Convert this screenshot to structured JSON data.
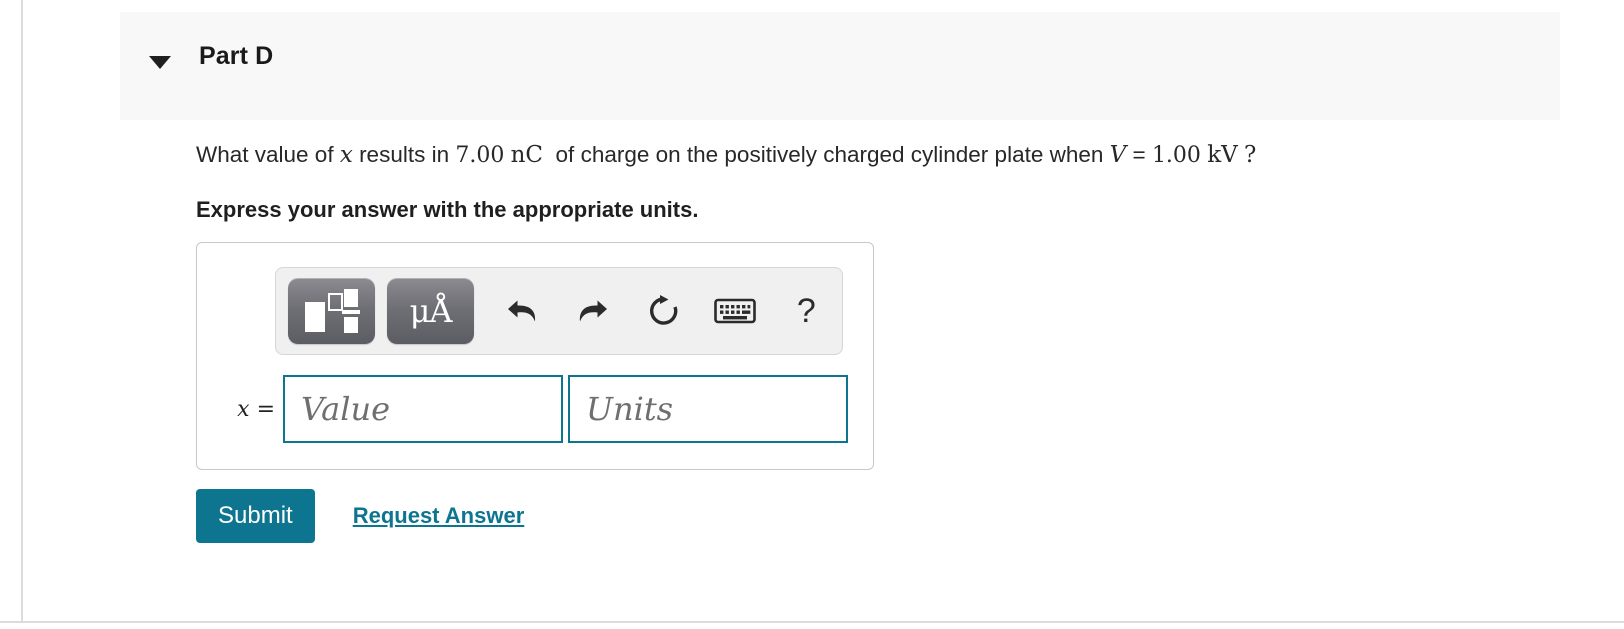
{
  "part": {
    "title": "Part D",
    "toggle_icon": "caret-down-icon",
    "expanded": true
  },
  "question": {
    "seg1": "What value of ",
    "var_x": "x",
    "seg2": " results in ",
    "num_charge": "7.00",
    "unit_charge": "nC",
    "seg3": " of charge on the positively charged cylinder plate when ",
    "var_v": "V",
    "equals": "=",
    "num_voltage": "1.00",
    "unit_voltage": "kV",
    "question_mark": "?"
  },
  "instruction": "Express your answer with the appropriate units.",
  "toolbar": {
    "buttons": [
      {
        "name": "math-template-button",
        "icon": "math-template-icon",
        "label": ""
      },
      {
        "name": "units-button",
        "icon": "micro-angstrom-icon",
        "label": "μÅ"
      },
      {
        "name": "undo-button",
        "icon": "undo-arrow-icon",
        "label": ""
      },
      {
        "name": "redo-button",
        "icon": "redo-arrow-icon",
        "label": ""
      },
      {
        "name": "reset-button",
        "icon": "refresh-icon",
        "label": ""
      },
      {
        "name": "keyboard-button",
        "icon": "keyboard-icon",
        "label": ""
      },
      {
        "name": "help-button",
        "icon": "question-mark-icon",
        "label": "?"
      }
    ]
  },
  "answer": {
    "variable_label": "x",
    "equals_sign": "=",
    "value_placeholder": "Value",
    "value": "",
    "units_placeholder": "Units",
    "units": ""
  },
  "actions": {
    "submit_label": "Submit",
    "request_answer_label": "Request Answer"
  },
  "colors": {
    "accent_teal": "#0d7590",
    "header_bg": "#f8f8f8",
    "toolbar_bg": "#f0f0f0",
    "rule": "#dcdcdc"
  }
}
